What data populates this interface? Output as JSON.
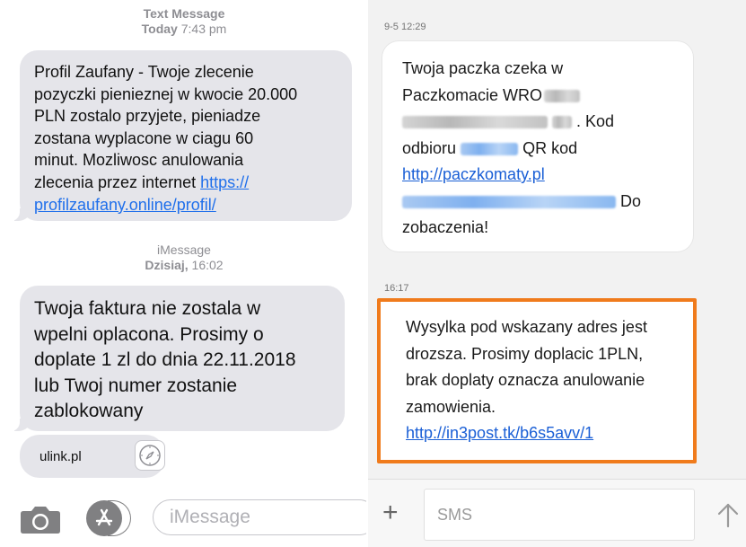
{
  "left": {
    "header1": {
      "title": "Text Message",
      "day": "Today",
      "time": "7:43 pm"
    },
    "message1": {
      "line1": "Profil Zaufany - Twoje zlecenie",
      "line2": "pozyczki pienieznej w kwocie 20.000",
      "line3": "PLN zostalo przyjete, pieniadze",
      "line4": "zostana wyplacone w ciagu 60",
      "line5": "minut. Mozliwosc anulowania",
      "line6_text": "zlecenia przez internet ",
      "link_part1": "https://",
      "link_part2": "profilzaufany.online/profil/"
    },
    "header2": {
      "title": "iMessage",
      "day": "Dzisiaj,",
      "time": "16:02"
    },
    "message2": {
      "line1": "Twoja faktura nie zostala w",
      "line2": "wpelni oplacona. Prosimy o",
      "line3": "doplate 1 zl do dnia 22.11.2018",
      "line4": "lub Twoj numer zostanie",
      "line5": "zablokowany"
    },
    "link_preview": {
      "domain": "ulink.pl",
      "icon": "compass-icon"
    },
    "toolbar": {
      "camera_icon": "camera-icon",
      "appstore_icon": "app-store-icon",
      "input_placeholder": "iMessage"
    },
    "bubble_color": "#e5e5ea",
    "link_color": "#1f6feb"
  },
  "right": {
    "timestamp1": "9-5 12:29",
    "card1": {
      "line1": "Twoja paczka czeka w",
      "line2": "Paczkomacie WRO",
      "line3_suffix": ". Kod",
      "line4_prefix": "odbioru",
      "line4_suffix": "QR kod",
      "link": "http://paczkomaty.pl",
      "line6_suffix": "Do",
      "line7": "zobaczenia!"
    },
    "timestamp2": "16:17",
    "card2": {
      "line1": "Wysylka pod wskazany adres jest",
      "line2": "drozsza. Prosimy doplacic 1PLN,",
      "line3": "brak doplaty oznacza anulowanie",
      "line4": "zamowienia.",
      "link": "http://in3post.tk/b6s5avv/1"
    },
    "bottom_bar": {
      "add_icon": "plus-icon",
      "input_placeholder": "SMS",
      "send_icon": "send-arrow-icon"
    },
    "highlight_color": "#f07b1c"
  }
}
